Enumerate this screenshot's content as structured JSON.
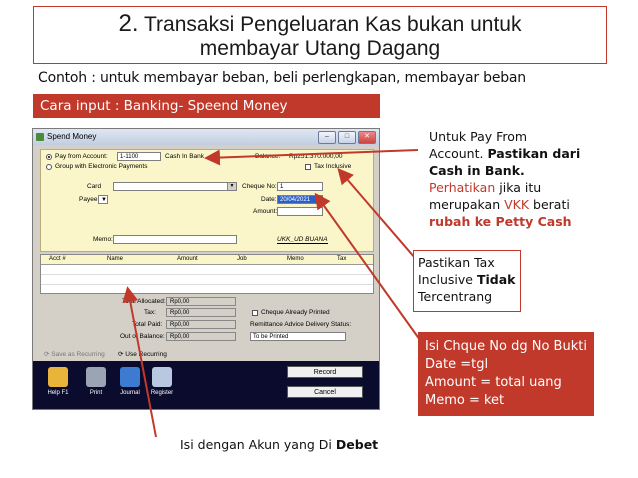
{
  "slide": {
    "title_num": "2.",
    "title_line1": "Transaksi Pengeluaran Kas bukan untuk",
    "title_line2": "membayar Utang Dagang",
    "example": "Contoh : untuk membayar beban, beli perlengkapan, membayar beban",
    "banner": "Cara input : Banking- Speend Money",
    "accent": "#c0392b"
  },
  "window": {
    "title": "Spend Money",
    "pay_from_label": "Pay from Account:",
    "pay_from_value": "1-1100",
    "pay_from_name": "Cash In Bank",
    "balance_label": "Balance:",
    "balance_value": "Rp251.370.000,00",
    "group_label": "Group with Electronic Payments",
    "tax_inclusive_label": "Tax Inclusive",
    "card_label": "Card",
    "cheque_label": "Cheque No:",
    "cheque_value": "1",
    "payee_label": "Payee",
    "date_label": "Date:",
    "date_value": "20/04/2021",
    "amount_label": "Amount:",
    "memo_label": "Memo:",
    "company_name": "UKK_UD BUANA",
    "columns": [
      "Acct #",
      "Name",
      "Amount",
      "Job",
      "Memo",
      "Tax"
    ],
    "total_allocated_label": "Total Allocated:",
    "total_allocated_value": "Rp0,00",
    "tax_label": "Tax:",
    "tax_value": "Rp0,00",
    "total_paid_label": "Total Paid:",
    "total_paid_value": "Rp0,00",
    "out_of_balance_label": "Out of Balance:",
    "out_of_balance_value": "Rp0,00",
    "cheque_printed_label": "Cheque Already Printed",
    "remittance_label": "Remittance Advice Delivery Status:",
    "remittance_value": "To be Printed",
    "save_recurring_label": "Save as Recurring",
    "use_recurring_label": "Use Recurring",
    "help_label": "Help F1",
    "print_label": "Print",
    "journal_label": "Journal",
    "register_label": "Register",
    "record_label": "Record",
    "cancel_label": "Cancel"
  },
  "notes": {
    "payfrom_1": "Untuk Pay From",
    "payfrom_2": "Account.",
    "payfrom_2b": "Pastikan dari",
    "payfrom_3": "Cash in Bank.",
    "payfrom_4a": "Perhatikan",
    "payfrom_4b": "jika itu",
    "payfrom_5a": "merupakan",
    "payfrom_5b": "VKK",
    "payfrom_5c": "berati",
    "payfrom_6": "rubah ke Petty Cash",
    "tax_1": "Pastikan Tax",
    "tax_2a": "Inclusive",
    "tax_2b": "Tidak",
    "tax_3": "Tercentrang",
    "isi_1": "Isi Chque No dg No Bukti",
    "isi_2": "Date =tgl",
    "isi_3": "Amount = total uang",
    "isi_4": "Memo = ket",
    "bottom_a": "Isi dengan Akun yang Di",
    "bottom_b": "Debet"
  }
}
